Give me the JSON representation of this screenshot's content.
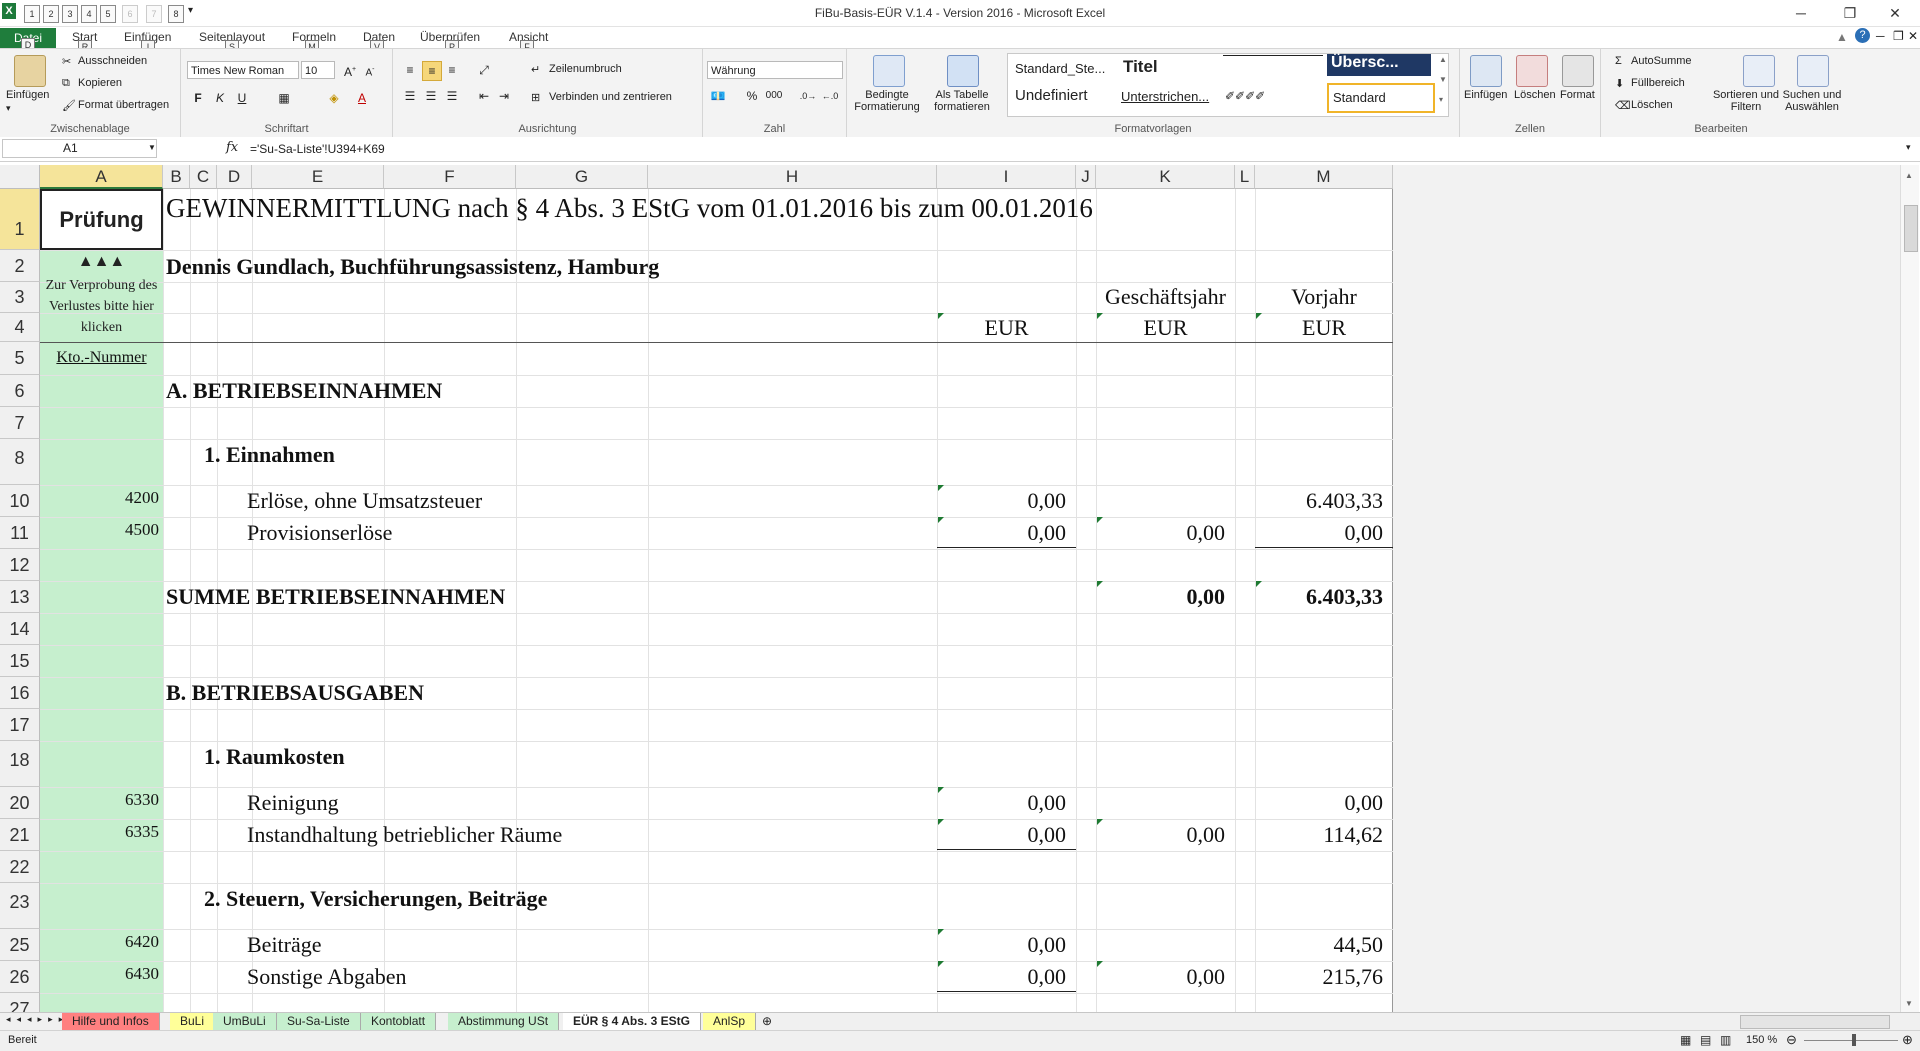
{
  "window": {
    "title": "FiBu-Basis-EÜR V.1.4 - Version 2016 - Microsoft Excel"
  },
  "qat": [
    "1",
    "2",
    "3",
    "4",
    "5",
    "6",
    "7",
    "8"
  ],
  "tabs": [
    {
      "label": "Datei",
      "key": "D"
    },
    {
      "label": "Start",
      "key": "R"
    },
    {
      "label": "Einfügen",
      "key": "I"
    },
    {
      "label": "Seitenlayout",
      "key": "S"
    },
    {
      "label": "Formeln",
      "key": "M"
    },
    {
      "label": "Daten",
      "key": "V"
    },
    {
      "label": "Überprüfen",
      "key": "P"
    },
    {
      "label": "Ansicht",
      "key": "F"
    }
  ],
  "ribbon": {
    "clipboard": {
      "paste": "Einfügen",
      "cut": "Ausschneiden",
      "copy": "Kopieren",
      "format_painter": "Format übertragen",
      "label": "Zwischenablage"
    },
    "font": {
      "name": "Times New Roman",
      "size": "10",
      "bold": "F",
      "italic": "K",
      "underline": "U",
      "label": "Schriftart"
    },
    "alignment": {
      "wrap": "Zeilenumbruch",
      "merge": "Verbinden und zentrieren",
      "label": "Ausrichtung"
    },
    "number": {
      "format": "Währung",
      "percent": "%",
      "thousands": "000",
      "label": "Zahl"
    },
    "cond_format": "Bedingte Formatierung",
    "as_table": "Als Tabelle formatieren",
    "styles": {
      "s1": "Standard_Ste...",
      "s2": "Titel",
      "s3": "Übersc...",
      "s4": "Undefiniert",
      "s5": "Unterstrichen...",
      "s6": "Standard",
      "label": "Formatvorlagen"
    },
    "cells": {
      "insert": "Einfügen",
      "delete": "Löschen",
      "format": "Format",
      "label": "Zellen"
    },
    "editing": {
      "autosum": "AutoSumme",
      "fill": "Füllbereich",
      "clear": "Löschen",
      "sort": "Sortieren und Filtern",
      "find": "Suchen und Auswählen",
      "label": "Bearbeiten"
    }
  },
  "formula_bar": {
    "name_box": "A1",
    "fx": "fx",
    "formula": "='Su-Sa-Liste'!U394+K69"
  },
  "columns": [
    "A",
    "B",
    "C",
    "D",
    "E",
    "F",
    "G",
    "H",
    "I",
    "J",
    "K",
    "L",
    "M"
  ],
  "sheet": {
    "a1": "Prüfung",
    "a2": "▲▲▲",
    "a3": "Zur Verprobung des Verlustes bitte hier klicken",
    "a5": "Kto.-Nummer",
    "title": "GEWINNERMITTLUNG nach § 4 Abs. 3 EStG vom 01.01.2016 bis zum 00.01.2016",
    "subtitle": "Dennis Gundlach, Buchführungsassistenz, Hamburg",
    "k3": "Geschäftsjahr",
    "m3": "Vorjahr",
    "eur": "EUR",
    "sec_a": "A. BETRIEBSEINNAHMEN",
    "sub_a1": "1. Einnahmen",
    "sum_a": "SUMME BETRIEBSEINNAHMEN",
    "sum_a_k": "0,00",
    "sum_a_m": "6.403,33",
    "sec_b": "B. BETRIEBSAUSGABEN",
    "sub_b1": "1. Raumkosten",
    "sub_b2": "2. Steuern, Versicherungen, Beiträge",
    "lines": {
      "r10": {
        "acct": "4200",
        "label": "Erlöse, ohne Umsatzsteuer",
        "i": "0,00",
        "k": "",
        "m": "6.403,33"
      },
      "r11": {
        "acct": "4500",
        "label": "Provisionserlöse",
        "i": "0,00",
        "k": "0,00",
        "m": "0,00"
      },
      "r20": {
        "acct": "6330",
        "label": "Reinigung",
        "i": "0,00",
        "k": "",
        "m": "0,00"
      },
      "r21": {
        "acct": "6335",
        "label": "Instandhaltung betrieblicher Räume",
        "i": "0,00",
        "k": "0,00",
        "m": "114,62"
      },
      "r25": {
        "acct": "6420",
        "label": "Beiträge",
        "i": "0,00",
        "k": "",
        "m": "44,50"
      },
      "r26": {
        "acct": "6430",
        "label": "Sonstige Abgaben",
        "i": "0,00",
        "k": "0,00",
        "m": "215,76"
      }
    }
  },
  "row_numbers": [
    "1",
    "2",
    "3",
    "4",
    "5",
    "6",
    "7",
    "8",
    "10",
    "11",
    "12",
    "13",
    "14",
    "15",
    "16",
    "17",
    "18",
    "20",
    "21",
    "22",
    "23",
    "25",
    "26",
    "27"
  ],
  "sheet_tabs": [
    "Hilfe und Infos",
    "BuLi",
    "UmBuLi",
    "Su-Sa-Liste",
    "Kontoblatt",
    "Abstimmung USt",
    "EÜR § 4 Abs. 3 EStG",
    "AnlSp"
  ],
  "status": {
    "ready": "Bereit",
    "zoom": "150 %"
  },
  "colors": {
    "accent_green": "#1f7d3c",
    "helper_col": "#c6efce",
    "tab_red": "#ff8080",
    "tab_green": "#c6efce",
    "tab_yellow": "#ffff99"
  }
}
